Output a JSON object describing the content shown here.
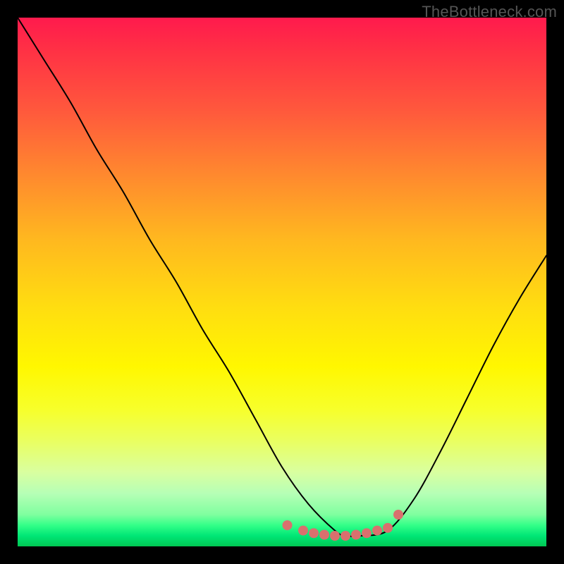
{
  "watermark": "TheBottleneck.com",
  "chart_data": {
    "type": "line",
    "title": "",
    "xlabel": "",
    "ylabel": "",
    "xlim": [
      0,
      100
    ],
    "ylim": [
      0,
      100
    ],
    "grid": false,
    "legend": false,
    "series": [
      {
        "name": "curve",
        "color": "#000000",
        "x": [
          0,
          5,
          10,
          15,
          20,
          25,
          30,
          35,
          40,
          45,
          50,
          55,
          60,
          62,
          65,
          70,
          75,
          80,
          85,
          90,
          95,
          100
        ],
        "values": [
          100,
          92,
          84,
          75,
          67,
          58,
          50,
          41,
          33,
          24,
          15,
          8,
          3,
          2,
          2,
          3,
          9,
          18,
          28,
          38,
          47,
          55
        ]
      }
    ],
    "highlight": {
      "name": "bottom-dots",
      "color": "#d9706e",
      "x": [
        51,
        54,
        56,
        58,
        60,
        62,
        64,
        66,
        68,
        70,
        72
      ],
      "values": [
        4,
        3,
        2.5,
        2.2,
        2,
        2,
        2.2,
        2.5,
        3,
        3.5,
        6
      ]
    }
  }
}
